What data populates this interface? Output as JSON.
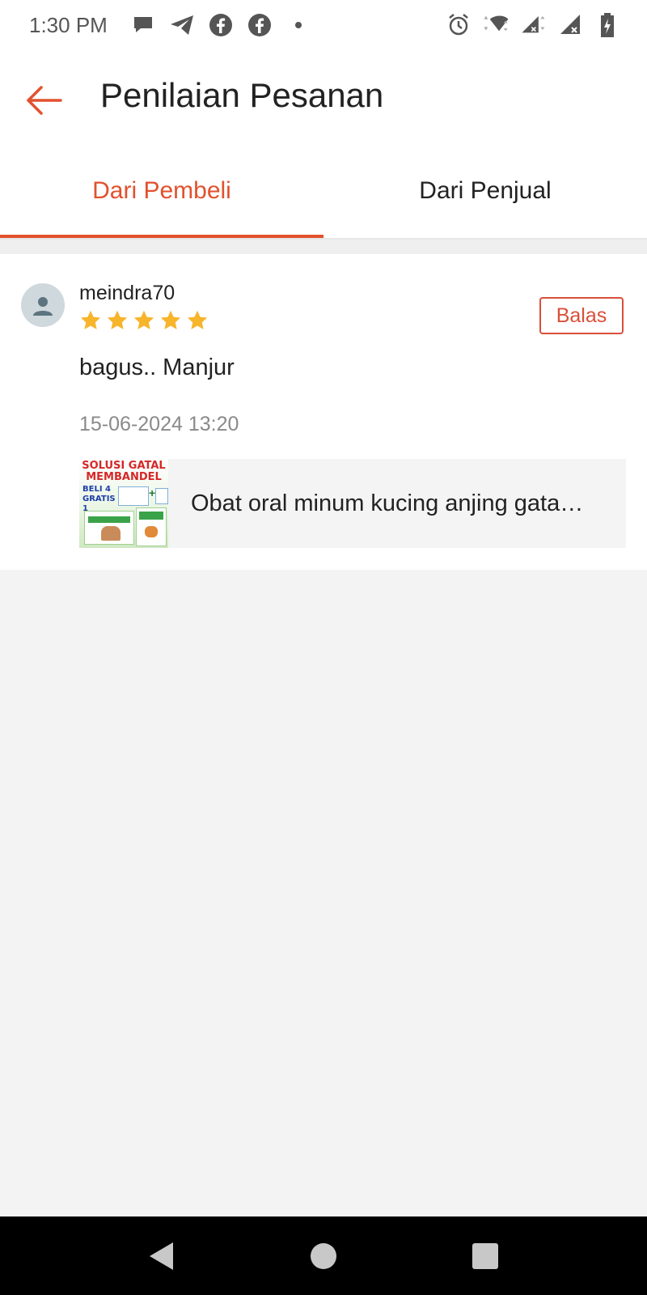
{
  "status_bar": {
    "time": "1:30 PM",
    "left_icons": [
      "chat-bubble-icon",
      "telegram-icon",
      "facebook-icon",
      "facebook-icon",
      "dot-icon"
    ],
    "right_icons": [
      "alarm-icon",
      "wifi-icon",
      "signal-icon",
      "signal-icon",
      "battery-charging-icon"
    ]
  },
  "header": {
    "back_icon": "back-arrow-icon",
    "title": "Penilaian Pesanan"
  },
  "tabs": [
    {
      "label": "Dari Pembeli",
      "active": true
    },
    {
      "label": "Dari Penjual",
      "active": false
    }
  ],
  "review": {
    "username": "meindra70",
    "rating": 5,
    "rating_max": 5,
    "reply_label": "Balas",
    "text": "bagus.. Manjur",
    "date": "15-06-2024 13:20",
    "product": {
      "thumb_title": "SOLUSI GATAL MEMBANDEL",
      "thumb_promo": "BELI 4 GRATIS 1",
      "name": "Obat oral minum kucing anjing gata…"
    }
  },
  "nav_bar": {
    "icons": [
      "back-triangle-icon",
      "home-circle-icon",
      "recents-square-icon"
    ]
  },
  "colors": {
    "accent": "#e2512d",
    "star": "#f7b52c",
    "reply_border": "#d9503a",
    "background": "#f3f3f3"
  }
}
